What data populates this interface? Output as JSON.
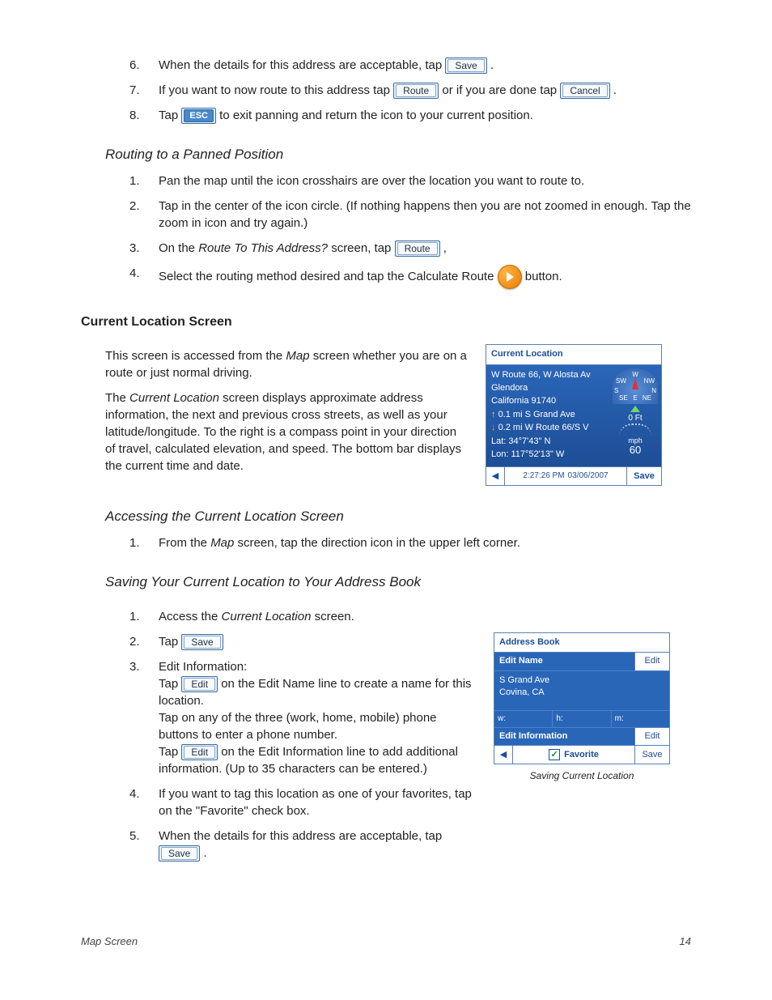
{
  "steps_a": {
    "6": {
      "n": "6.",
      "pre": "When the details for this address are acceptable, tap ",
      "btn": "Save",
      "post": " ."
    },
    "7": {
      "n": "7.",
      "pre": "If you want to now route to this address tap ",
      "btn1": "Route",
      "mid": " or if you are done tap ",
      "btn2": "Cancel",
      "post": " ."
    },
    "8": {
      "n": "8.",
      "pre": "Tap ",
      "btn": "ESC",
      "post": " to exit panning and return the icon to your current position."
    }
  },
  "subhead1": "Routing to a Panned Position",
  "steps_b": {
    "1": {
      "n": "1.",
      "t": "Pan the map until the icon crosshairs are over the location you want to route to."
    },
    "2": {
      "n": "2.",
      "t": "Tap in the center of the icon circle.  (If nothing happens then you are not zoomed in enough.  Tap the zoom in icon and try again.)"
    },
    "3": {
      "n": "3.",
      "pre": "On the ",
      "em": "Route To This Address?",
      "mid": " screen, tap ",
      "btn": "Route",
      "post": " ,"
    },
    "4": {
      "n": "4.",
      "pre": "Select the routing method desired and tap the Calculate Route ",
      "post": " button."
    }
  },
  "section1": "Current Location Screen",
  "para1_pre": "This screen is accessed from the ",
  "para1_em": "Map",
  "para1_post": " screen whether you are on a route or just normal driving.",
  "para2_pre": "The ",
  "para2_em": "Current Location",
  "para2_post": " screen displays approximate address information, the next and previous cross streets, as well as your latitude/longitude.  To the right is a compass point in your direction of travel, calculated elevation, and speed.  The bottom bar displays the current time and date.",
  "subhead2": "Accessing the Current Location Screen",
  "steps_c": {
    "1": {
      "n": "1.",
      "pre": "From the ",
      "em": "Map",
      "post": " screen, tap the direction icon in the upper left corner."
    }
  },
  "subhead3": "Saving Your Current Location to Your Address Book",
  "steps_d": {
    "1": {
      "n": "1.",
      "pre": "Access the ",
      "em": "Current Location",
      "post": " screen."
    },
    "2": {
      "n": "2.",
      "pre": "Tap ",
      "btn": "Save"
    },
    "3": {
      "n": "3.",
      "hdr": "Edit Information:",
      "a_pre": "Tap ",
      "a_btn": "Edit",
      "a_post": " on the Edit Name line to create a name for this location.",
      "b": "Tap on any of the three (work, home, mobile) phone buttons to enter a phone number.",
      "c_pre": "Tap ",
      "c_btn": "Edit",
      "c_post": " on the Edit Information line to add additional information.  (Up to 35 characters can be entered.)"
    },
    "4": {
      "n": "4.",
      "t": "If you want to tag this location as one of your favorites, tap on the \"Favorite\" check box."
    },
    "5": {
      "n": "5.",
      "pre": "When the details for this address are acceptable, tap ",
      "btn": "Save",
      "post": " ."
    }
  },
  "shot_cl": {
    "title": "Current Location",
    "addr1": "W Route 66, W Alosta Av",
    "addr2": "Glendora",
    "addr3": "California 91740",
    "next": "0.1 mi S Grand Ave",
    "prev": "0.2 mi W Route 66/S V",
    "lat": "Lat:  34°7'43\"   N",
    "lon": "Lon: 117°52'13\"   W",
    "elev": "0 Ft",
    "speed_unit": "mph",
    "speed_val": "60",
    "compass_labels": {
      "n": "N",
      "s": "S",
      "e": "E",
      "w": "W",
      "ne": "NE",
      "nw": "NW",
      "se": "SE",
      "sw": "SW"
    },
    "time": "2:27:26 PM",
    "date": "03/06/2007",
    "save": "Save"
  },
  "shot_ab": {
    "title": "Address Book",
    "editname": "Edit Name",
    "edit": "Edit",
    "addr1": "S Grand Ave",
    "addr2": "Covina, CA",
    "w": "w:",
    "h": "h:",
    "m": "m:",
    "editinfo": "Edit Information",
    "favorite": "Favorite",
    "save": "Save",
    "caption": "Saving Current Location"
  },
  "footer": {
    "left": "Map Screen",
    "right": "14"
  }
}
